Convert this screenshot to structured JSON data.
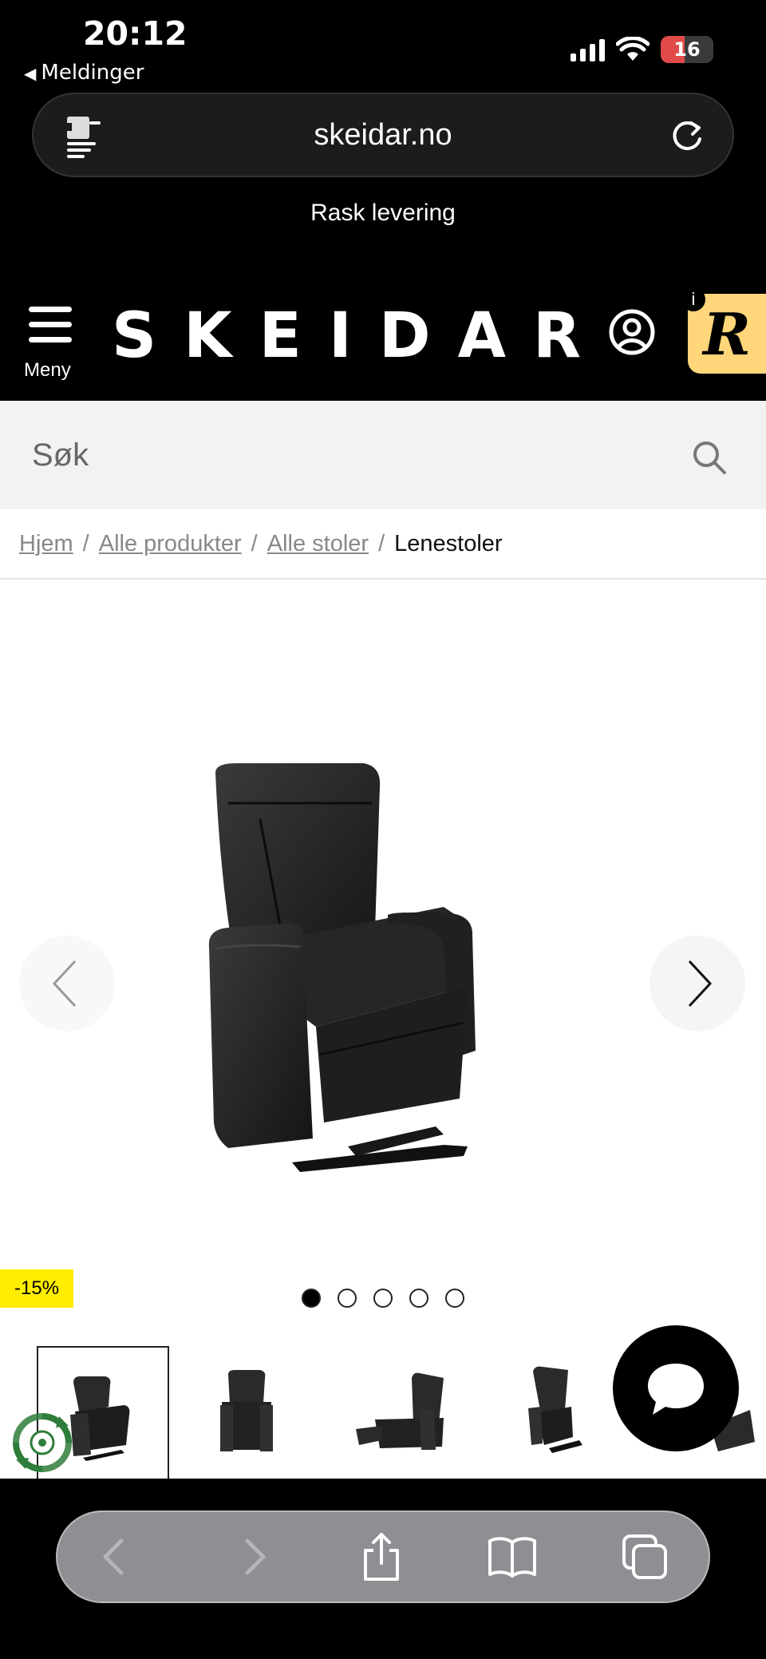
{
  "status_bar": {
    "time": "20:12",
    "back_label": "Meldinger",
    "battery": "16"
  },
  "browser": {
    "url": "skeidar.no"
  },
  "banner": {
    "text": "Rask levering"
  },
  "header": {
    "logo": "SKEIDAR",
    "menu_label": "Meny",
    "badge_letter": "R",
    "info_letter": "i"
  },
  "search": {
    "placeholder": "Søk"
  },
  "breadcrumb": {
    "items": [
      "Hjem",
      "Alle produkter",
      "Alle stoler"
    ],
    "separator": "/",
    "current": "Lenestoler"
  },
  "product": {
    "discount": "-15%",
    "image_count": 5,
    "active_image": 1
  },
  "colors": {
    "accent_yellow": "#ffee00",
    "badge_yellow": "#ffd77a",
    "eco_green": "#2f7d3a"
  }
}
